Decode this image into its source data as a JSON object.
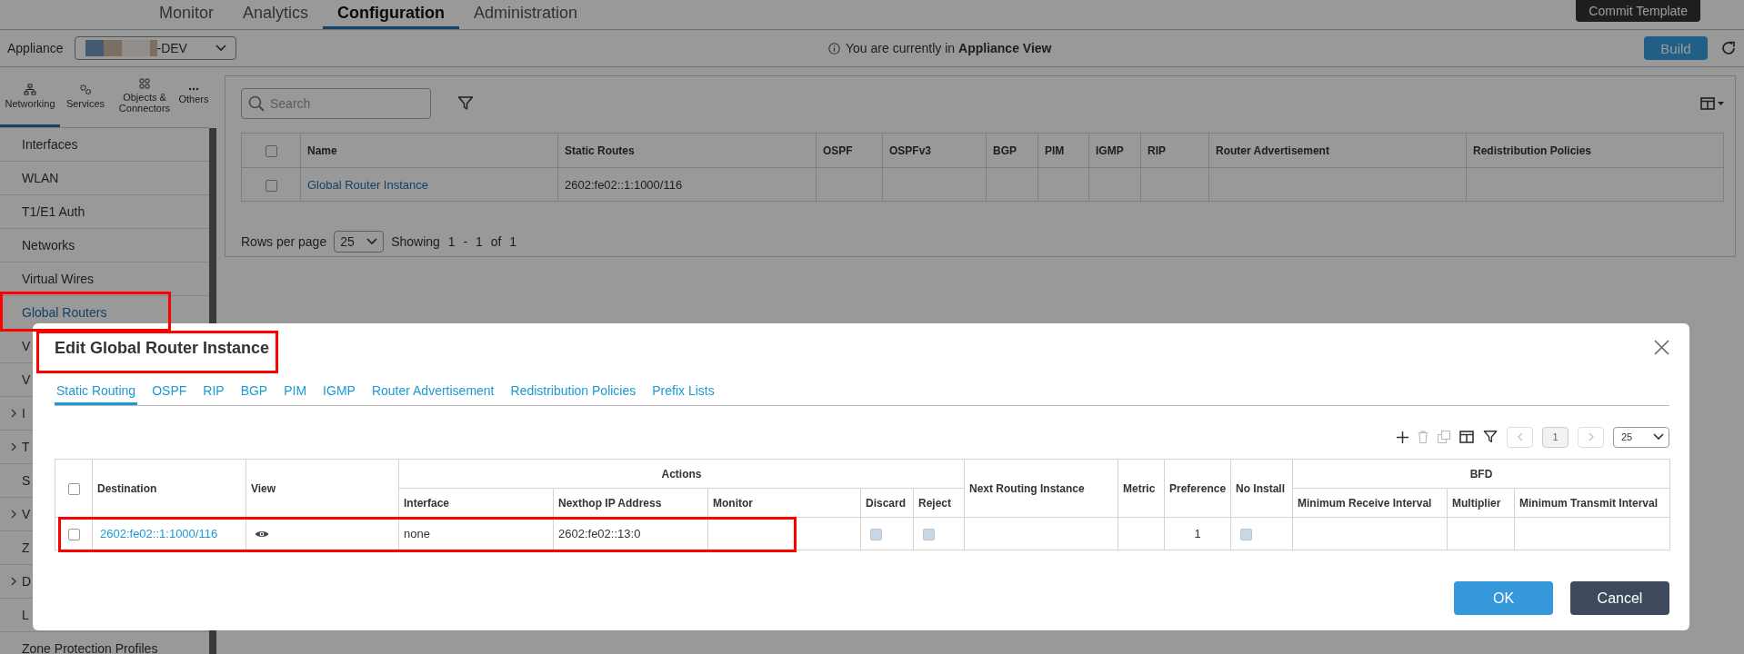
{
  "top_nav": {
    "tabs": [
      {
        "label": "Monitor",
        "selected": false
      },
      {
        "label": "Analytics",
        "selected": false
      },
      {
        "label": "Configuration",
        "selected": true
      },
      {
        "label": "Administration",
        "selected": false
      }
    ],
    "commit_button": "Commit Template"
  },
  "context_bar": {
    "appliance_label": "Appliance",
    "appliance_value": "-DEV",
    "info": "You are currently in **Appliance View**",
    "build_button": "Build"
  },
  "sidebar": {
    "categories": [
      {
        "kind": "network",
        "label": "Networking",
        "selected": true
      },
      {
        "kind": "services",
        "label": "Services",
        "selected": false
      },
      {
        "kind": "objects",
        "label": "Objects & Connectors",
        "selected": false
      },
      {
        "kind": "others",
        "label": "Others",
        "selected": false
      }
    ],
    "items": [
      {
        "label": "Interfaces",
        "selected": false,
        "expandable": false,
        "highlighted": false
      },
      {
        "label": "WLAN",
        "selected": false,
        "expandable": false,
        "highlighted": false
      },
      {
        "label": "T1/E1 Auth",
        "selected": false,
        "expandable": false,
        "highlighted": false
      },
      {
        "label": "Networks",
        "selected": false,
        "expandable": false,
        "highlighted": false
      },
      {
        "label": "Virtual Wires",
        "selected": false,
        "expandable": false,
        "highlighted": false
      },
      {
        "label": "Global Routers",
        "selected": true,
        "expandable": false,
        "highlighted": true
      },
      {
        "label": "V",
        "selected": false,
        "expandable": false,
        "highlighted": false
      },
      {
        "label": "V",
        "selected": false,
        "expandable": false,
        "highlighted": false
      },
      {
        "label": "I",
        "selected": false,
        "expandable": true,
        "highlighted": false
      },
      {
        "label": "T",
        "selected": false,
        "expandable": true,
        "highlighted": false
      },
      {
        "label": "S",
        "selected": false,
        "expandable": false,
        "highlighted": false
      },
      {
        "label": "V",
        "selected": false,
        "expandable": true,
        "highlighted": false
      },
      {
        "label": "Z",
        "selected": false,
        "expandable": false,
        "highlighted": false
      },
      {
        "label": "D",
        "selected": false,
        "expandable": true,
        "highlighted": false
      },
      {
        "label": "L",
        "selected": false,
        "expandable": false,
        "highlighted": false
      },
      {
        "label": "Zone Protection Profiles",
        "selected": false,
        "expandable": false,
        "highlighted": false
      }
    ]
  },
  "main": {
    "search_placeholder": "Search",
    "table": {
      "columns": [
        "Name",
        "Static Routes",
        "OSPF",
        "OSPFv3",
        "BGP",
        "PIM",
        "IGMP",
        "RIP",
        "Router Advertisement",
        "Redistribution Policies"
      ],
      "all_selected": false,
      "rows": [
        {
          "selected": false,
          "name": "Global Router Instance",
          "static_routes": "2602:fe02::1:1000/116"
        }
      ]
    },
    "pagination": {
      "label": "Rows per page",
      "page_size": "25",
      "showing": "Showing 1 - 1 of 1"
    }
  },
  "modal": {
    "title": "Edit Global Router Instance",
    "title_highlighted": true,
    "tabs": [
      {
        "label": "Static Routing",
        "selected": true
      },
      {
        "label": "OSPF",
        "selected": false
      },
      {
        "label": "RIP",
        "selected": false
      },
      {
        "label": "BGP",
        "selected": false
      },
      {
        "label": "PIM",
        "selected": false
      },
      {
        "label": "IGMP",
        "selected": false
      },
      {
        "label": "Router Advertisement",
        "selected": false
      },
      {
        "label": "Redistribution Policies",
        "selected": false
      },
      {
        "label": "Prefix Lists",
        "selected": false
      }
    ],
    "toolbar": {
      "delete_disabled": true,
      "copy_disabled": true,
      "prev_disabled": true,
      "next_disabled": true,
      "page": "1",
      "page_size": "25"
    },
    "columns": [
      {
        "kind": "select",
        "checked": false
      },
      {
        "kind": "label",
        "label": "Destination"
      },
      {
        "kind": "label",
        "label": "View"
      },
      {
        "kind": "group",
        "label": "Actions",
        "colspan": 5,
        "children": [
          {
            "label": "Interface"
          },
          {
            "label": "Nexthop IP Address"
          },
          {
            "label": "Monitor"
          },
          {
            "label": "Discard"
          },
          {
            "label": "Reject"
          }
        ]
      },
      {
        "kind": "label",
        "label": "Next Routing Instance"
      },
      {
        "kind": "label",
        "label": "Metric"
      },
      {
        "kind": "label",
        "label": "Preference"
      },
      {
        "kind": "label",
        "label": "No Install"
      },
      {
        "kind": "group",
        "label": "BFD",
        "colspan": 3,
        "children": [
          {
            "label": "Minimum Receive Interval"
          },
          {
            "label": "Multiplier"
          },
          {
            "label": "Minimum Transmit Interval"
          }
        ]
      }
    ],
    "rows": [
      {
        "highlighted": true,
        "cells": [
          {
            "kind": "select",
            "checked": false
          },
          {
            "kind": "link",
            "text": "2602:fe02::1:1000/116"
          },
          {
            "kind": "view"
          },
          {
            "kind": "text",
            "text": "none"
          },
          {
            "kind": "text",
            "text": "2602:fe02::13:0"
          },
          {
            "kind": "empty"
          },
          {
            "kind": "check",
            "checked": false
          },
          {
            "kind": "check",
            "checked": false
          },
          {
            "kind": "empty"
          },
          {
            "kind": "empty"
          },
          {
            "kind": "number",
            "text": "1"
          },
          {
            "kind": "check",
            "checked": false
          },
          {
            "kind": "empty"
          },
          {
            "kind": "empty"
          },
          {
            "kind": "empty"
          }
        ]
      }
    ],
    "ok_button": "OK",
    "cancel_button": "Cancel"
  }
}
